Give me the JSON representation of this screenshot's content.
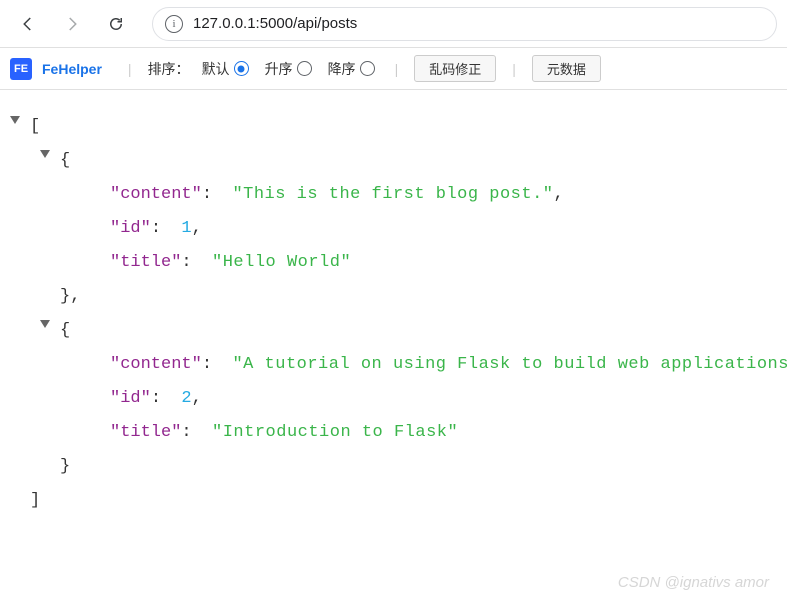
{
  "browser": {
    "url": "127.0.0.1:5000/api/posts"
  },
  "fehelper": {
    "name": "FeHelper",
    "logo_text": "FE",
    "sort_label": "排序：",
    "sort_options": {
      "default": "默认",
      "asc": "升序",
      "desc": "降序"
    },
    "selected_sort": "default",
    "btn_fix": "乱码修正",
    "btn_meta": "元数据"
  },
  "json": {
    "items": [
      {
        "content": "This is the first blog post.",
        "id": 1,
        "title": "Hello World"
      },
      {
        "content": "A tutorial on using Flask to build web applications.",
        "id": 2,
        "title": "Introduction to Flask"
      }
    ],
    "keys": {
      "content": "content",
      "id": "id",
      "title": "title"
    },
    "q": "\""
  },
  "watermark": "CSDN @ignativs  amor"
}
